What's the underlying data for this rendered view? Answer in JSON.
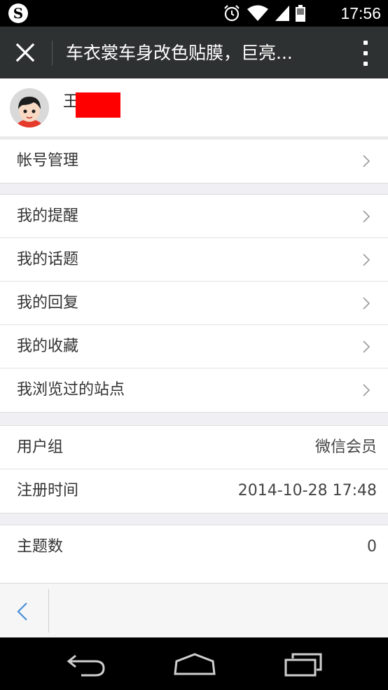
{
  "status_bar": {
    "time": "17:56",
    "icons": [
      "alarm-icon",
      "wifi-icon",
      "signal-icon",
      "battery-icon"
    ],
    "logo": "S"
  },
  "title_bar": {
    "title": "车衣裳车身改色贴膜，巨亮...",
    "close_icon": "close-icon",
    "menu_icon": "more-vertical-icon"
  },
  "profile": {
    "name": "王",
    "avatar_icon": "avatar-icon"
  },
  "groups": [
    {
      "rows": [
        {
          "label": "帐号管理"
        }
      ]
    },
    {
      "rows": [
        {
          "label": "我的提醒"
        },
        {
          "label": "我的话题"
        },
        {
          "label": "我的回复"
        },
        {
          "label": "我的收藏"
        },
        {
          "label": "我浏览过的站点"
        }
      ]
    },
    {
      "rows": [
        {
          "label": "用户组",
          "value": "微信会员"
        },
        {
          "label": "注册时间",
          "value": "2014-10-28 17:48"
        }
      ]
    },
    {
      "rows": [
        {
          "label": "主题数",
          "value": "0"
        }
      ]
    }
  ],
  "colors": {
    "title_bar_bg": "#2e3132",
    "page_bg": "#efeff4",
    "redaction": "#ff0000",
    "back_arrow": "#4a90d9"
  }
}
